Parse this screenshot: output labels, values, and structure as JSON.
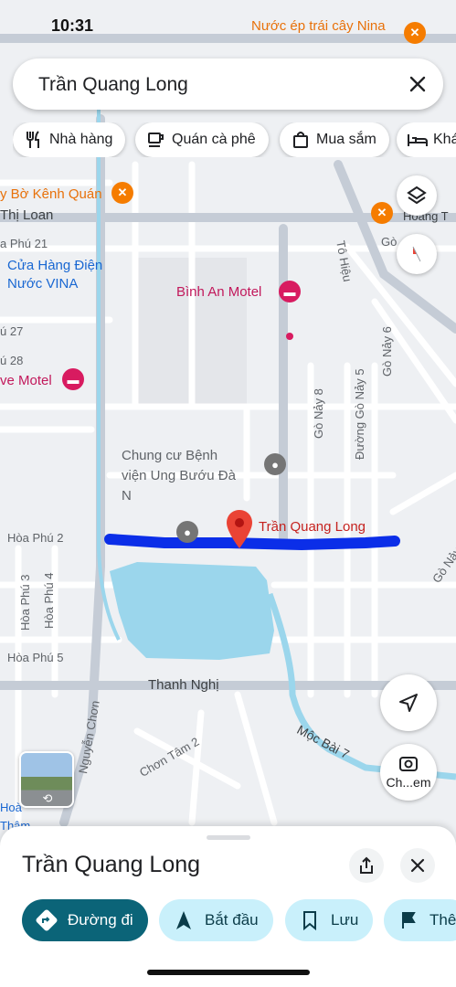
{
  "status_bar": {
    "time": "10:31",
    "right_text": "Nước ép trái cây Nina"
  },
  "search": {
    "query": "Trần Quang Long"
  },
  "chips": [
    {
      "label": "Nhà hàng",
      "icon": "restaurant-icon"
    },
    {
      "label": "Quán cà phê",
      "icon": "coffee-icon"
    },
    {
      "label": "Mua sắm",
      "icon": "shopping-bag-icon"
    },
    {
      "label": "Khá",
      "icon": "hotel-icon"
    }
  ],
  "map": {
    "places": {
      "bo_kenh_quan": "y Bờ Kênh Quán",
      "cua_hang": "Cửa Hàng Điện Nước VINA",
      "binh_an_motel": "Bình An Motel",
      "ve_motel": "ve Motel",
      "chung_cu": "Chung cư Bệnh viện Ung Bướu Đà N",
      "selected": "Trần Quang Long"
    },
    "roads": {
      "thi_loan": "Thị Loan",
      "hoang": "Hoàng T",
      "hoa_phu_21": "a Phú 21",
      "hoa_phu_27": "ú 27",
      "hoa_phu_28": "ú 28",
      "hoa_phu_2": "Hòa Phú 2",
      "hoa_phu_3": "Hòa Phú 3",
      "hoa_phu_4": "Hòa Phú 4",
      "hoa_phu_5": "Hòa Phú 5",
      "thanh_nghi": "Thanh Nghị",
      "nguyen_chon": "Nguyễn Chơn",
      "chon_tam_2": "Chơn Tâm 2",
      "moc_bai_7": "Mộc Bài 7",
      "to_hieu": "Tô Hiệu",
      "go_nay_8": "Gò Nảy 8",
      "go_nay_5": "Đường Gò Nảy 5",
      "go_nay_6": "Gò Nảy 6",
      "go_nay": "Gò Nảy",
      "go": "Gò",
      "hoa_bottom": "Hoà",
      "tham": "Thâm"
    },
    "lens_label": "Ch...em"
  },
  "place_sheet": {
    "title": "Trần Quang Long",
    "actions": [
      {
        "label": "Đường đi",
        "icon": "directions-icon"
      },
      {
        "label": "Bắt đầu",
        "icon": "navigation-icon"
      },
      {
        "label": "Lưu",
        "icon": "bookmark-icon"
      },
      {
        "label": "Thê",
        "icon": "flag-icon"
      }
    ]
  },
  "colors": {
    "route": "#0b2ee8",
    "water": "#9bd6ec",
    "primary_action": "#0b6478",
    "secondary_action": "#c9f0fb",
    "poi_pink": "#d81b60",
    "poi_orange": "#f57c00"
  }
}
